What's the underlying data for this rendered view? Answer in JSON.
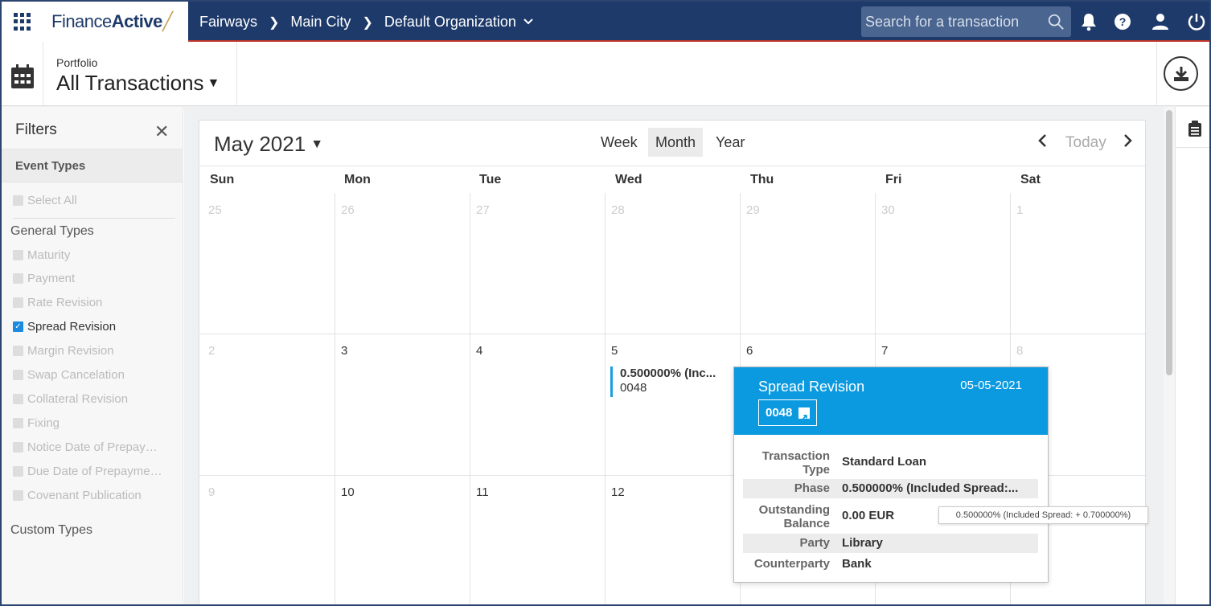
{
  "app": {
    "logo_regular": "Finance",
    "logo_bold": "Active",
    "breadcrumb": [
      "Fairways",
      "Main City",
      "Default Organization"
    ],
    "search_placeholder": "Search for a transaction"
  },
  "header": {
    "portfolio_label": "Portfolio",
    "portfolio_title": "All Transactions"
  },
  "filters": {
    "title": "Filters",
    "event_types_label": "Event Types",
    "select_all": "Select All",
    "general_types_label": "General Types",
    "general_types": [
      {
        "label": "Maturity",
        "checked": false
      },
      {
        "label": "Payment",
        "checked": false
      },
      {
        "label": "Rate Revision",
        "checked": false
      },
      {
        "label": "Spread Revision",
        "checked": true
      },
      {
        "label": "Margin Revision",
        "checked": false
      },
      {
        "label": "Swap Cancelation",
        "checked": false
      },
      {
        "label": "Collateral Revision",
        "checked": false
      },
      {
        "label": "Fixing",
        "checked": false
      },
      {
        "label": "Notice Date of Prepay…",
        "checked": false
      },
      {
        "label": "Due Date of Prepayme…",
        "checked": false
      },
      {
        "label": "Covenant Publication",
        "checked": false
      }
    ],
    "custom_types_label": "Custom Types"
  },
  "calendar": {
    "month_label": "May 2021",
    "views": [
      "Week",
      "Month",
      "Year"
    ],
    "active_view": "Month",
    "today_label": "Today",
    "weekdays": [
      "Sun",
      "Mon",
      "Tue",
      "Wed",
      "Thu",
      "Fri",
      "Sat"
    ],
    "weeks": [
      [
        {
          "d": "25",
          "muted": true
        },
        {
          "d": "26",
          "muted": true
        },
        {
          "d": "27",
          "muted": true
        },
        {
          "d": "28",
          "muted": true
        },
        {
          "d": "29",
          "muted": true
        },
        {
          "d": "30",
          "muted": true
        },
        {
          "d": "1",
          "muted": true
        }
      ],
      [
        {
          "d": "2",
          "muted": true
        },
        {
          "d": "3",
          "muted": false
        },
        {
          "d": "4",
          "muted": false
        },
        {
          "d": "5",
          "muted": false
        },
        {
          "d": "6",
          "muted": false
        },
        {
          "d": "7",
          "muted": false
        },
        {
          "d": "8",
          "muted": true
        }
      ],
      [
        {
          "d": "9",
          "muted": true
        },
        {
          "d": "10",
          "muted": false
        },
        {
          "d": "11",
          "muted": false
        },
        {
          "d": "12",
          "muted": false
        },
        {
          "d": "",
          "muted": false
        },
        {
          "d": "",
          "muted": false
        },
        {
          "d": "",
          "muted": true
        }
      ]
    ],
    "event": {
      "title": "0.500000% (Inc...",
      "subtitle": "0048"
    }
  },
  "popover": {
    "title": "Spread Revision",
    "date": "05-05-2021",
    "id": "0048",
    "rows": [
      {
        "key": "Transaction Type",
        "value": "Standard Loan"
      },
      {
        "key": "Phase",
        "value": "0.500000% (Included Spread:..."
      },
      {
        "key": "Outstanding Balance",
        "value": "0.00 EUR"
      },
      {
        "key": "Party",
        "value": "Library"
      },
      {
        "key": "Counterparty",
        "value": "Bank"
      }
    ]
  },
  "tooltip": "0.500000% (Included Spread: + 0.700000%)",
  "colors": {
    "navy": "#1e3a6b",
    "accent": "#0b9ae0"
  }
}
